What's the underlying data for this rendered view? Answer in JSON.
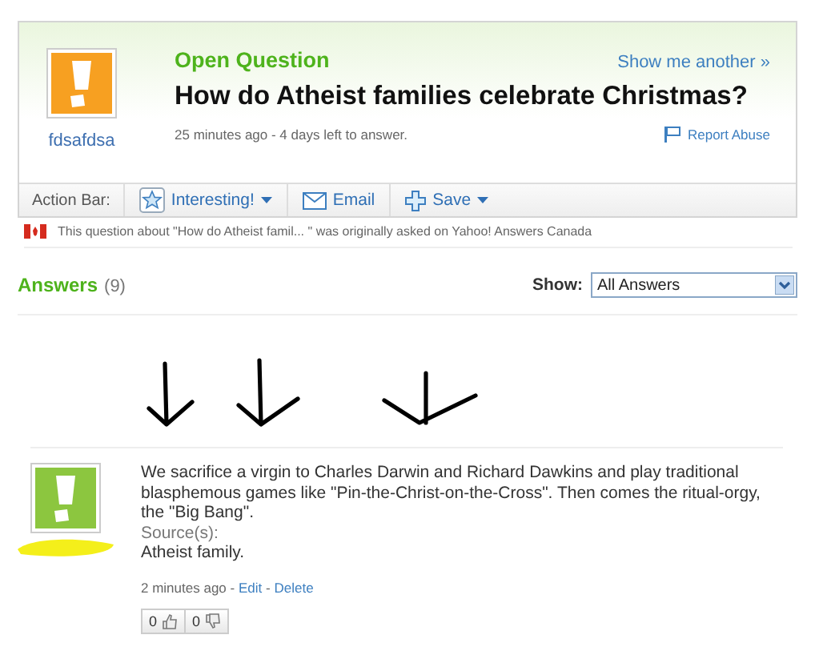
{
  "question": {
    "label": "Open Question",
    "show_another": "Show me another »",
    "title": "How do Atheist families celebrate Christmas?",
    "asker": "fdsafdsa",
    "meta": "25 minutes ago - 4 days left to answer.",
    "report": "Report Abuse"
  },
  "action_bar": {
    "label": "Action Bar:",
    "buttons": [
      {
        "label": "Interesting!",
        "kind": "star",
        "dropdown": true
      },
      {
        "label": "Email",
        "kind": "mail",
        "dropdown": false
      },
      {
        "label": "Save",
        "kind": "plus",
        "dropdown": true
      }
    ]
  },
  "notice": "This question about \"How do Atheist famil... \" was originally asked on Yahoo! Answers Canada",
  "answers_header": {
    "title": "Answers",
    "count": "(9)",
    "show_label": "Show:",
    "filter": "All Answers"
  },
  "answers": [
    {
      "text": "We sacrifice a virgin to Charles Darwin and Richard Dawkins and play traditional blasphemous games like \"Pin-the-Christ-on-the-Cross\". Then comes the ritual-orgy, the \"Big Bang\".",
      "source_label": "Source(s):",
      "source": "Atheist family.",
      "time": "2 minutes ago",
      "links": [
        {
          "separator": "-",
          "label": "Edit"
        },
        {
          "separator": "-",
          "label": "Delete"
        }
      ],
      "thumbs_up": "0",
      "thumbs_down": "0"
    }
  ]
}
